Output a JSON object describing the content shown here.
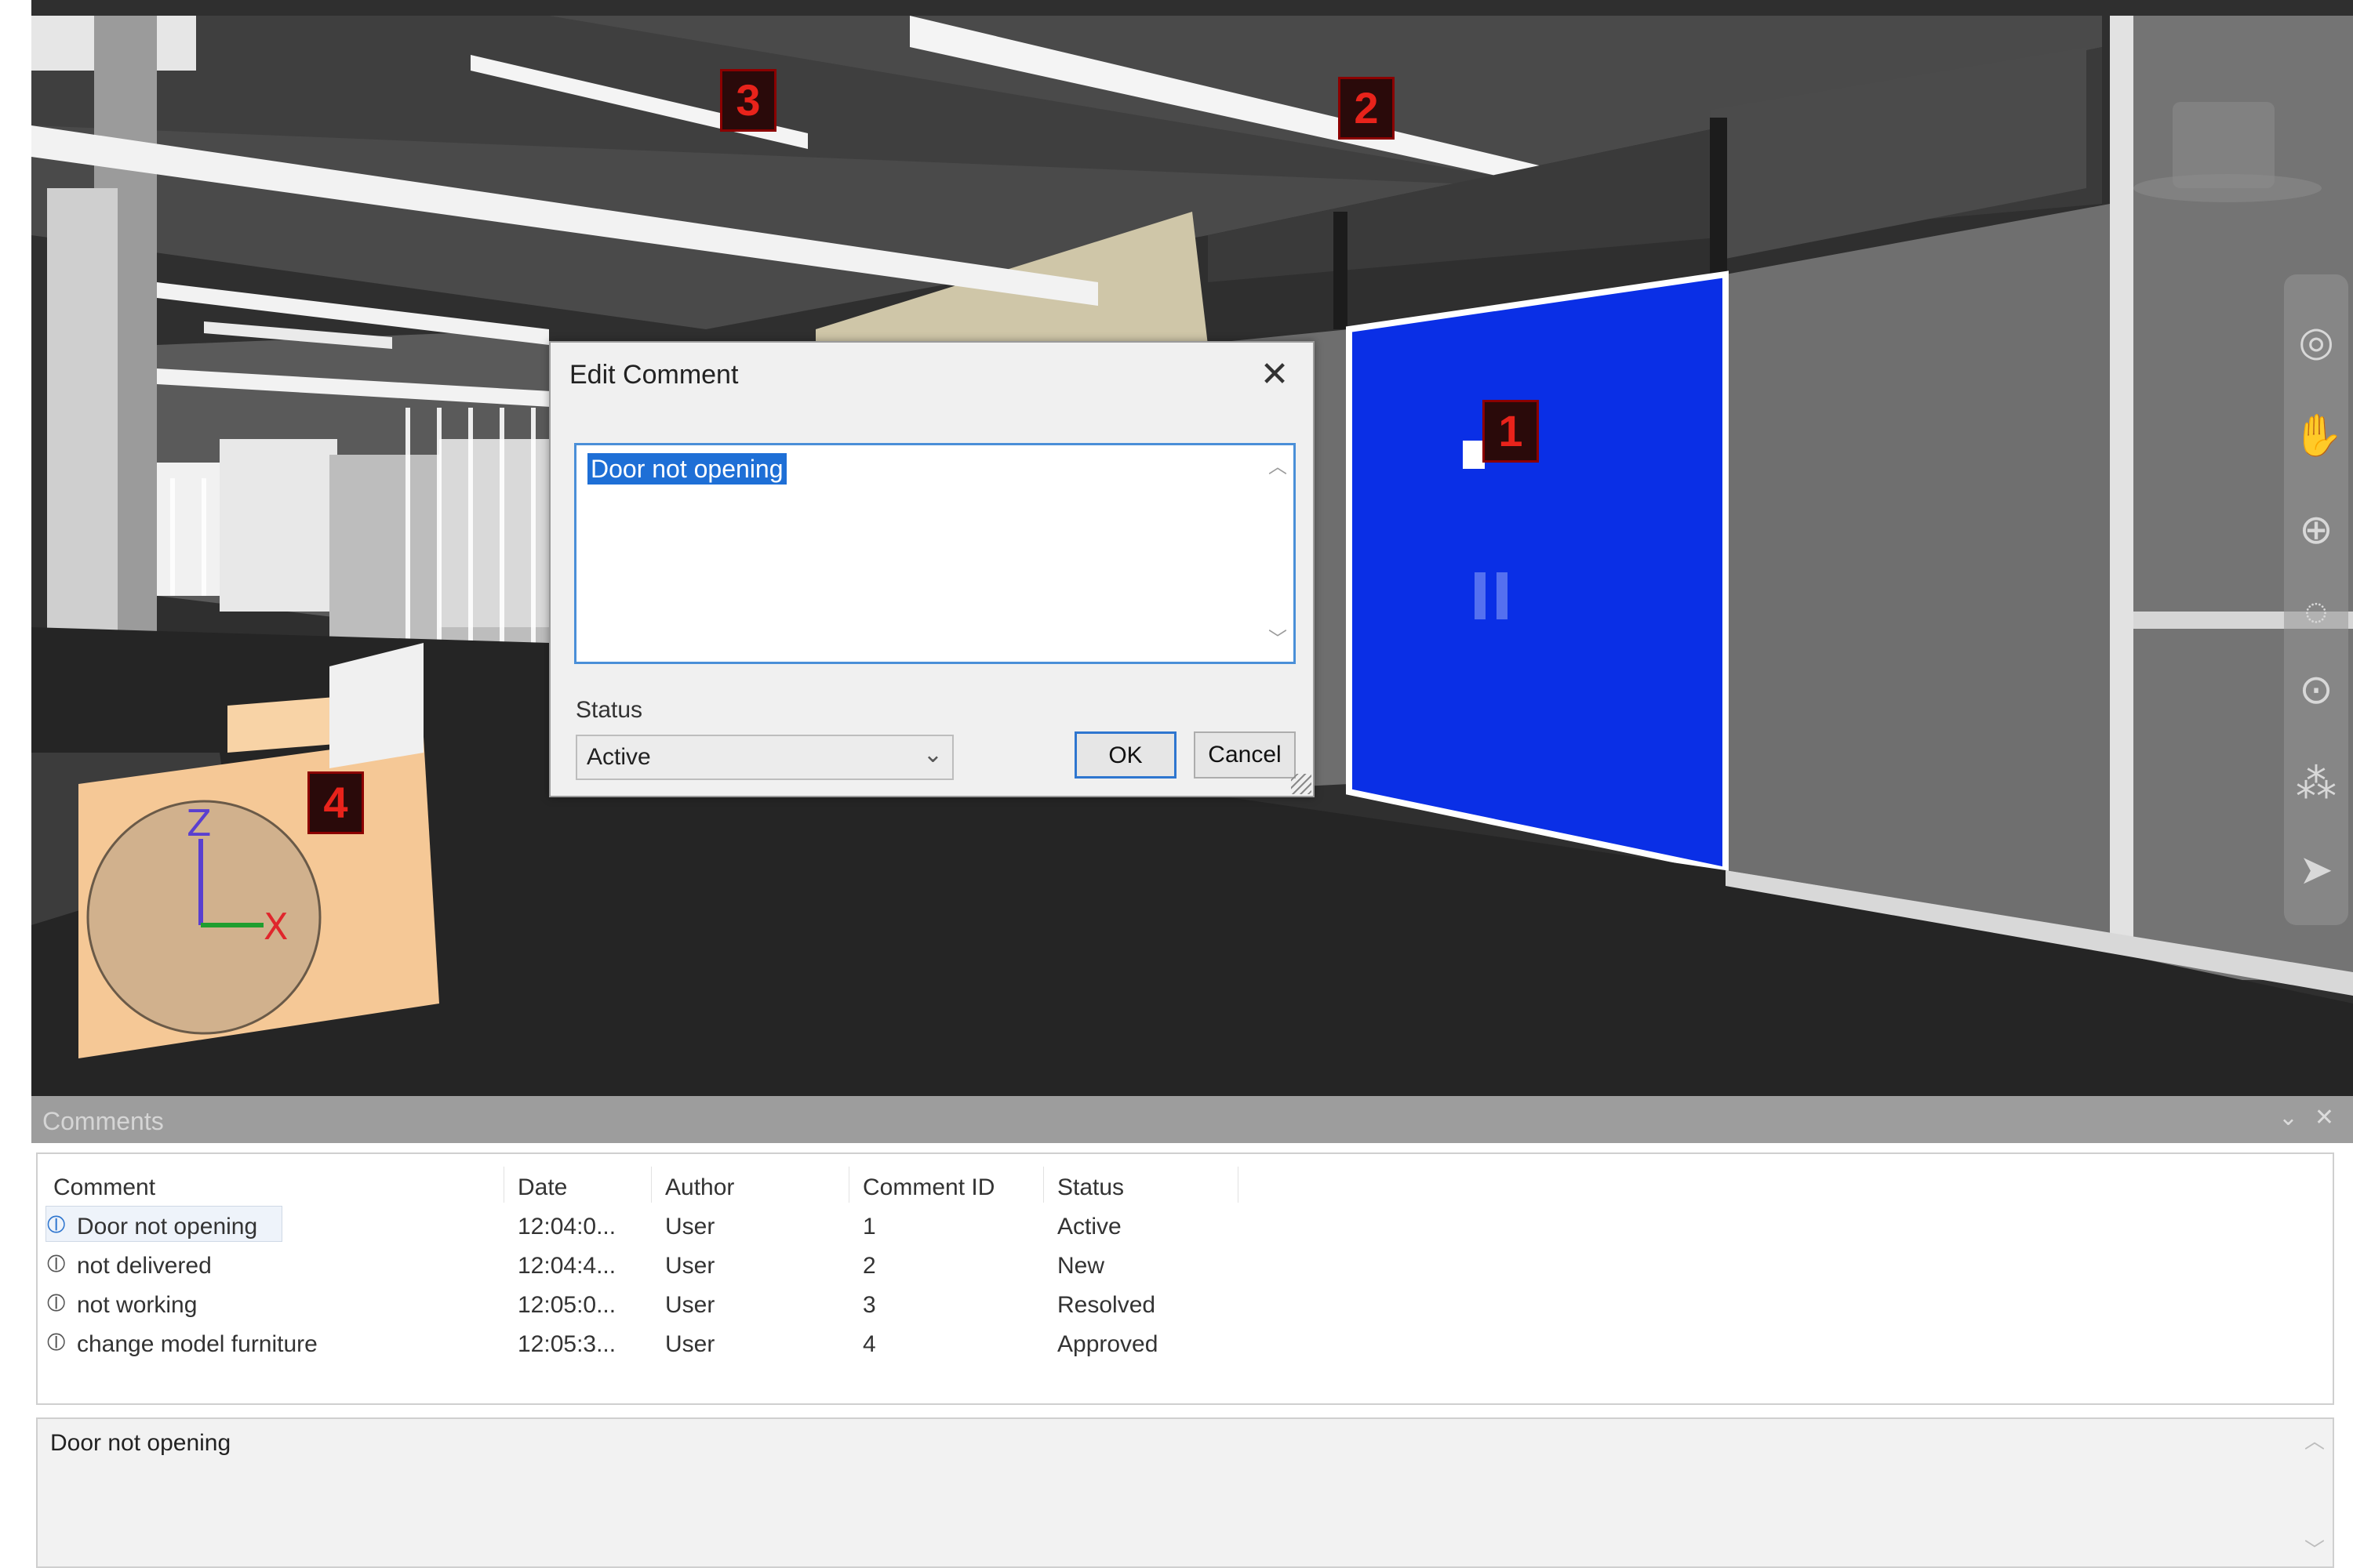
{
  "viewport": {
    "markers": [
      "3",
      "2",
      "1",
      "4"
    ],
    "axis_labels": {
      "z": "Z",
      "x": "X"
    },
    "nav_icons": [
      "orbit-icon",
      "pan-icon",
      "zoom-icon",
      "look-icon",
      "walk-icon",
      "center-icon",
      "pointer-icon"
    ]
  },
  "dialog": {
    "title": "Edit Comment",
    "text": "Door not opening",
    "status_label": "Status",
    "status_value": "Active",
    "ok_label": "OK",
    "cancel_label": "Cancel"
  },
  "comments_panel": {
    "title": "Comments",
    "columns": [
      "Comment",
      "Date",
      "Author",
      "Comment ID",
      "Status"
    ],
    "rows": [
      {
        "comment": "Door not opening",
        "date": "12:04:0...",
        "author": "User",
        "id": "1",
        "status": "Active"
      },
      {
        "comment": "not delivered",
        "date": "12:04:4...",
        "author": "User",
        "id": "2",
        "status": "New"
      },
      {
        "comment": "not working",
        "date": "12:05:0...",
        "author": "User",
        "id": "3",
        "status": "Resolved"
      },
      {
        "comment": "change model furniture",
        "date": "12:05:3...",
        "author": "User",
        "id": "4",
        "status": "Approved"
      }
    ],
    "preview_text": "Door not opening"
  }
}
